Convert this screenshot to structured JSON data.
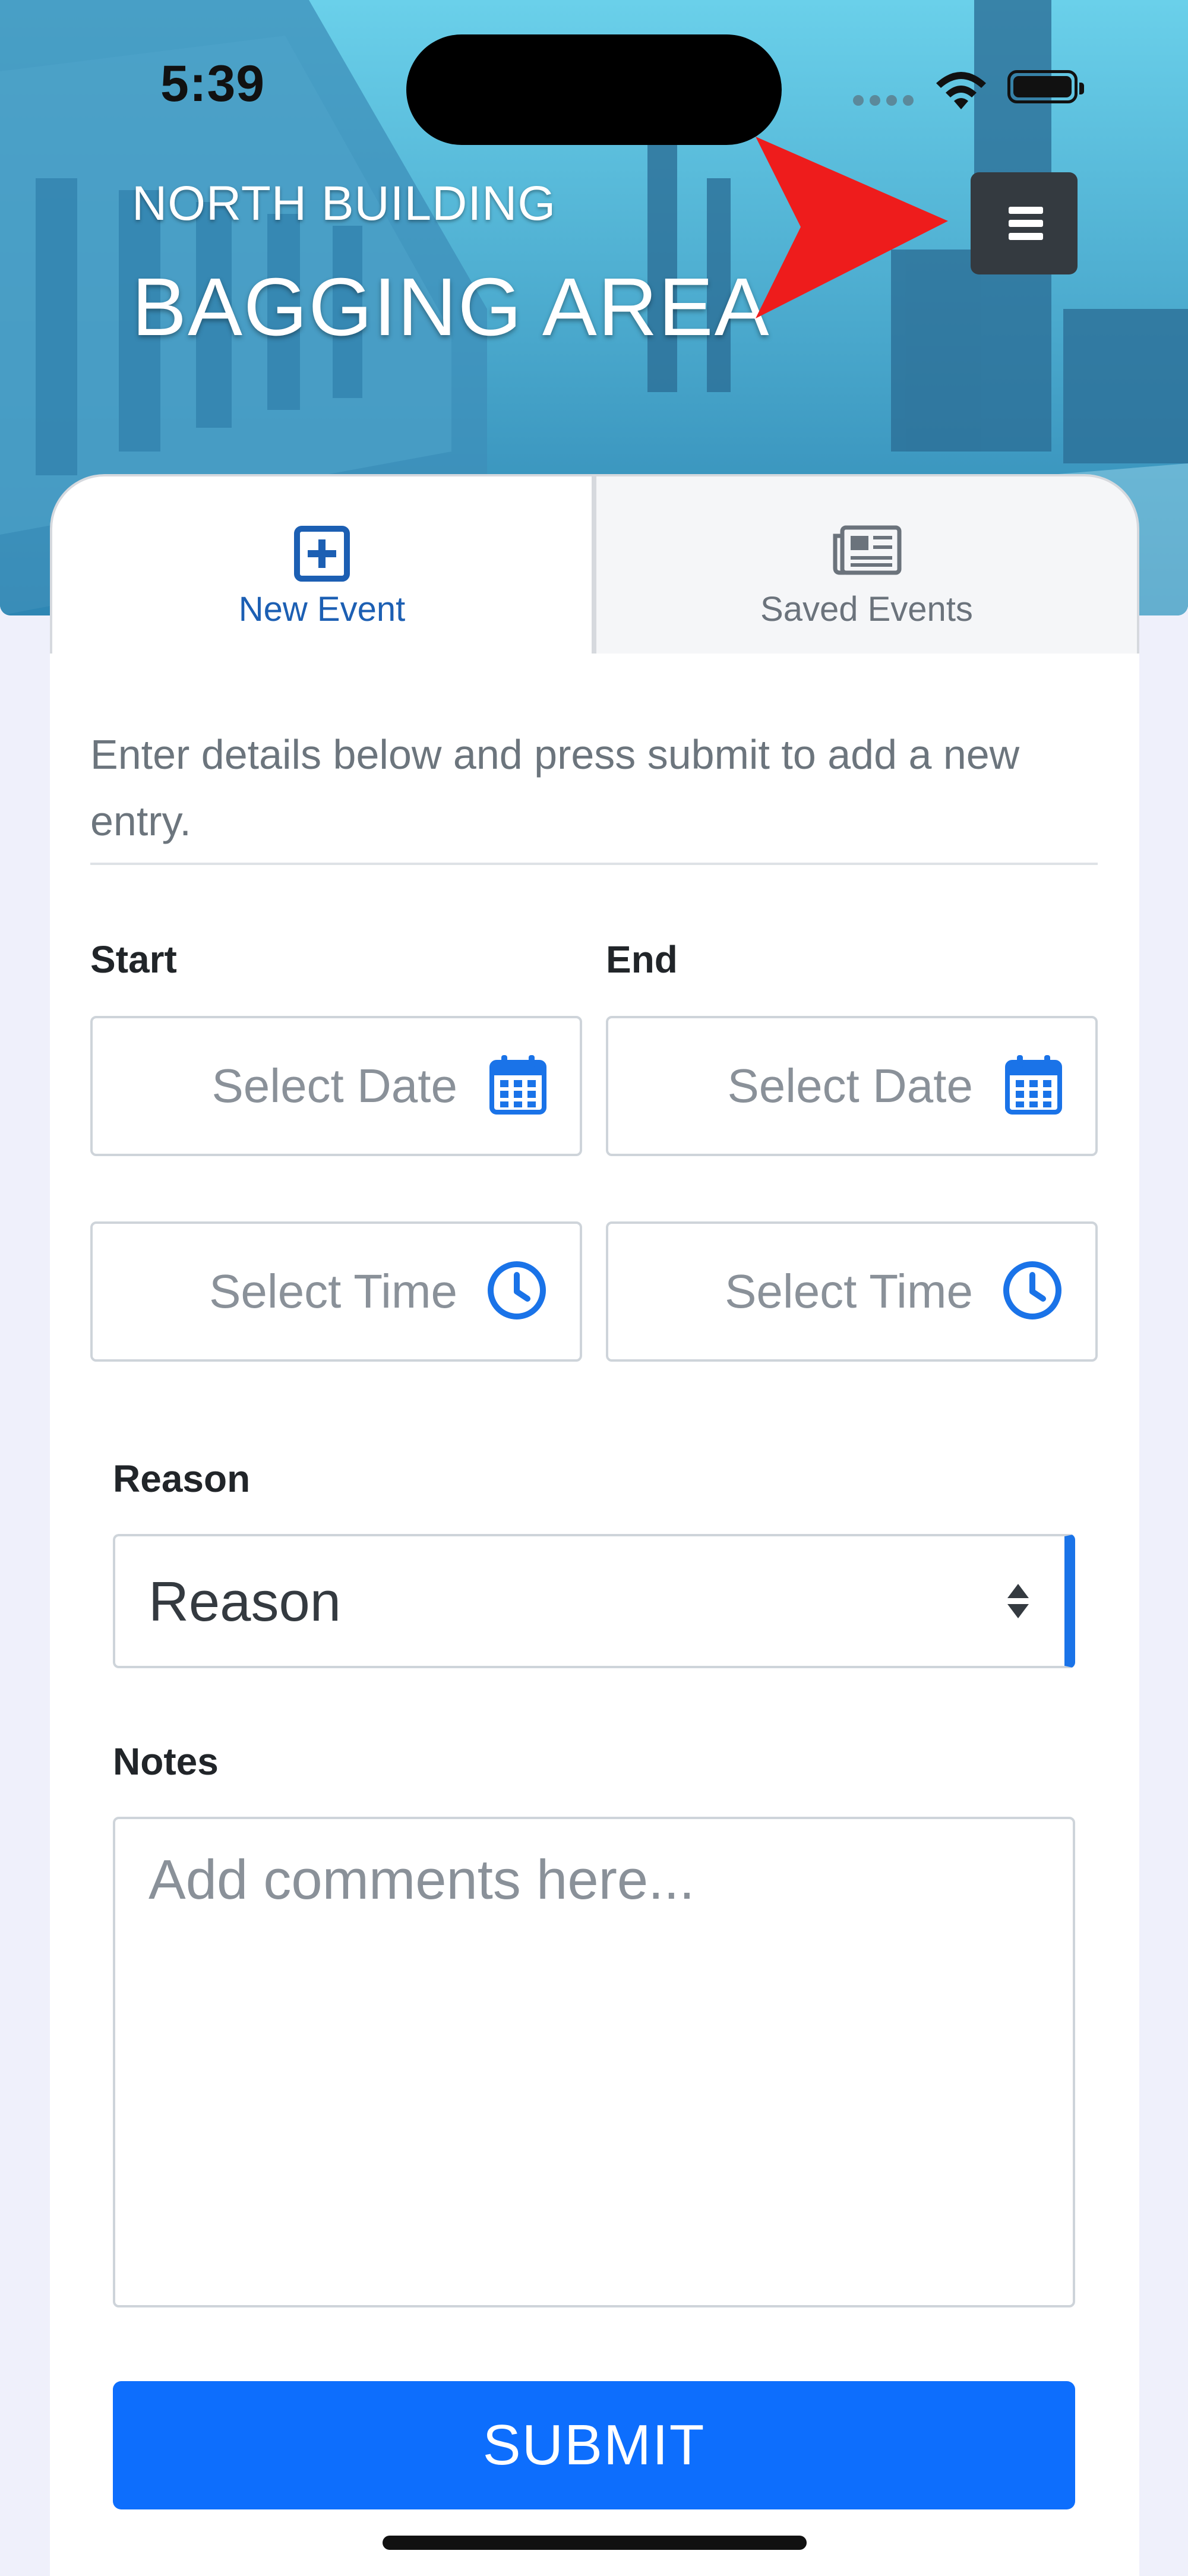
{
  "status_bar": {
    "time": "5:39"
  },
  "header": {
    "building": "NORTH BUILDING",
    "area": "BAGGING AREA",
    "menu_icon": "hamburger-icon",
    "annotation": "red-arrow-pointer"
  },
  "tabs": [
    {
      "label": "New Event",
      "icon": "plus-square-icon",
      "active": true
    },
    {
      "label": "Saved Events",
      "icon": "newspaper-icon",
      "active": false
    }
  ],
  "form": {
    "intro": "Enter details below and press submit to add a new entry.",
    "start_label": "Start",
    "end_label": "End",
    "start_date_placeholder": "Select Date",
    "end_date_placeholder": "Select Date",
    "start_time_placeholder": "Select Time",
    "end_time_placeholder": "Select Time",
    "reason_label": "Reason",
    "reason_value": "Reason",
    "notes_label": "Notes",
    "notes_placeholder": "Add comments here...",
    "submit_label": "SUBMIT"
  },
  "colors": {
    "accent": "#0d6efd",
    "header_tint": "#3a90bc",
    "menu_button": "#343a40",
    "annotation_red": "#ee1c1c"
  }
}
